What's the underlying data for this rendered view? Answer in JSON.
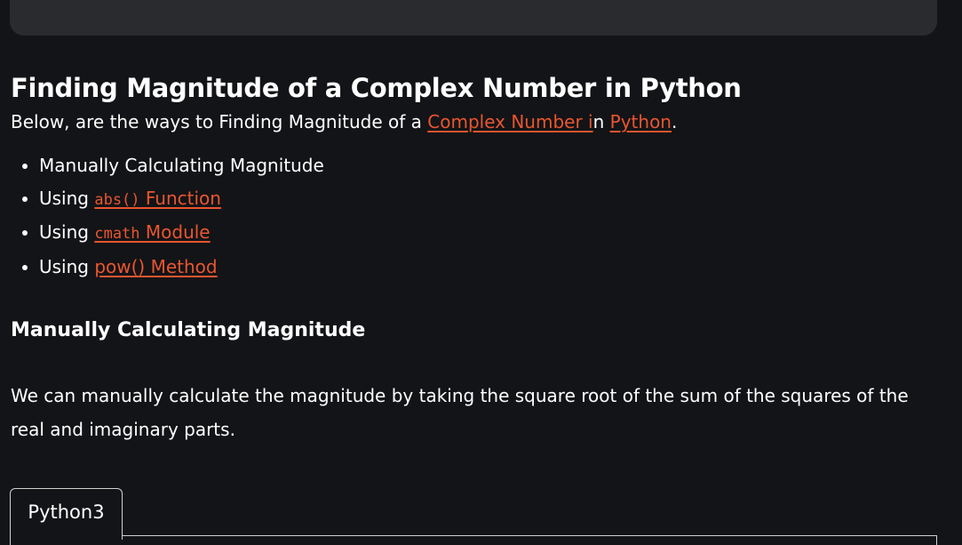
{
  "article": {
    "title": "Finding Magnitude of a Complex Number in Python",
    "intro": {
      "prefix": "Below, are the ways to Finding Magnitude of a ",
      "link1": "Complex Number i",
      "middle": "n ",
      "link2": "Python",
      "suffix": "."
    },
    "methods": [
      {
        "text": "Manually Calculating Magnitude"
      },
      {
        "prefix": "Using ",
        "code": "abs()",
        "link_rest": " Function"
      },
      {
        "prefix": "Using ",
        "code": "cmath",
        "link_rest": " Module"
      },
      {
        "prefix": "Using ",
        "link": "pow() Method"
      }
    ],
    "section_heading": "Manually Calculating Magnitude",
    "section_body": "We can manually calculate the magnitude by taking the square root of the sum of the squares of the real and imaginary parts."
  },
  "code_block": {
    "tab_label": "Python3"
  },
  "colors": {
    "background": "#131417",
    "link": "#e9562f",
    "panel": "#2a2b2e"
  }
}
